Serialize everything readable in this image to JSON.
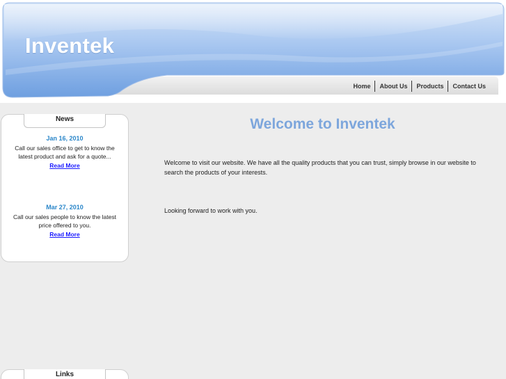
{
  "site": {
    "title": "Inventek"
  },
  "nav": {
    "items": [
      "Home",
      "About Us",
      "Products",
      "Contact Us"
    ]
  },
  "sidebar": {
    "news": {
      "heading": "News",
      "items": [
        {
          "date": "Jan 16, 2010",
          "text": "Call our sales office to get to know the latest product and ask for a quote...",
          "link": "Read More"
        },
        {
          "date": "Mar 27, 2010",
          "text": "Call our sales people to know the latest price offered to you.",
          "link": "Read More"
        }
      ]
    },
    "links": {
      "heading": "Links"
    }
  },
  "main": {
    "heading": "Welcome to Inventek",
    "paragraphs": [
      "Welcome to visit our website. We have all the quality products that you can trust, simply browse in our website to search the products of your interests.",
      "Looking forward to work with you."
    ]
  },
  "colors": {
    "banner_blue": "#7aaae6",
    "heading_blue": "#7da6dc",
    "date_blue": "#2a86c9",
    "link_blue": "#1a1aff",
    "page_bg": "#ededed"
  }
}
